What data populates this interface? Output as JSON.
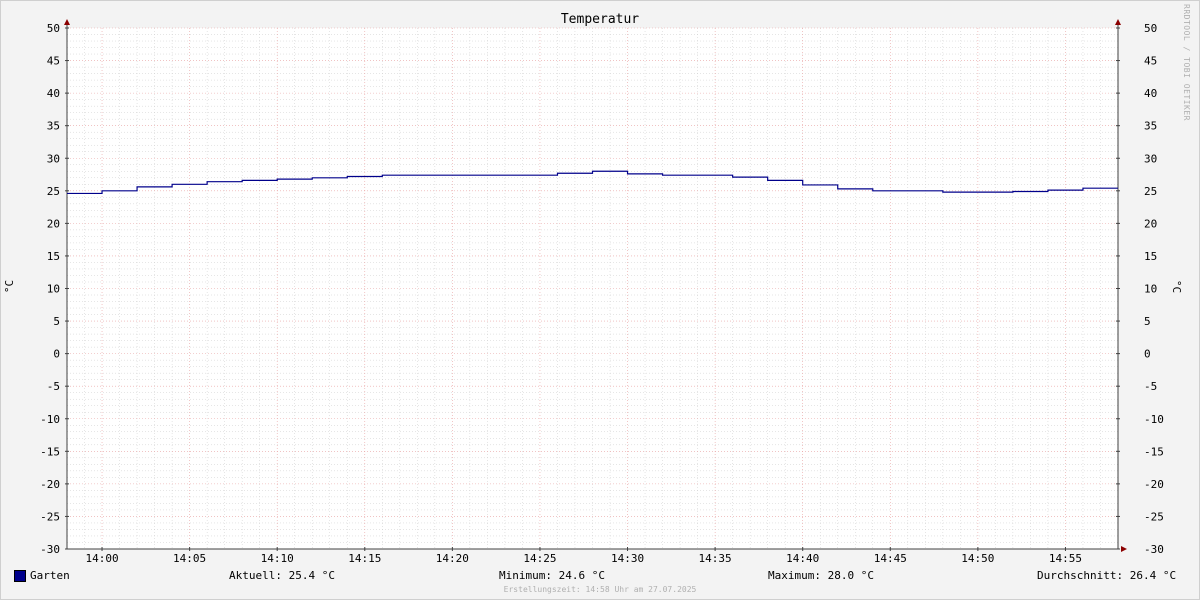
{
  "chart_data": {
    "type": "line",
    "title": "Temperatur",
    "ylabel": "°C",
    "ylim": [
      -30,
      50
    ],
    "y_ticks": [
      50,
      45,
      40,
      35,
      30,
      25,
      20,
      15,
      10,
      5,
      0,
      -5,
      -10,
      -15,
      -20,
      -25,
      -30
    ],
    "x_ticks": [
      "14:00",
      "14:05",
      "14:10",
      "14:15",
      "14:20",
      "14:25",
      "14:30",
      "14:35",
      "14:40",
      "14:45",
      "14:50",
      "14:55"
    ],
    "x_range": [
      "13:58",
      "14:58"
    ],
    "grid": true,
    "step": true,
    "series": [
      {
        "name": "Garten",
        "color": "#00008b",
        "points": [
          [
            "13:58",
            24.6
          ],
          [
            "14:00",
            25.0
          ],
          [
            "14:02",
            25.6
          ],
          [
            "14:04",
            26.0
          ],
          [
            "14:06",
            26.4
          ],
          [
            "14:08",
            26.6
          ],
          [
            "14:10",
            26.8
          ],
          [
            "14:12",
            27.0
          ],
          [
            "14:14",
            27.2
          ],
          [
            "14:16",
            27.4
          ],
          [
            "14:18",
            27.4
          ],
          [
            "14:20",
            27.4
          ],
          [
            "14:22",
            27.4
          ],
          [
            "14:24",
            27.4
          ],
          [
            "14:26",
            27.7
          ],
          [
            "14:28",
            28.0
          ],
          [
            "14:30",
            27.6
          ],
          [
            "14:32",
            27.4
          ],
          [
            "14:34",
            27.4
          ],
          [
            "14:36",
            27.1
          ],
          [
            "14:38",
            26.6
          ],
          [
            "14:40",
            25.9
          ],
          [
            "14:42",
            25.3
          ],
          [
            "14:44",
            25.0
          ],
          [
            "14:46",
            25.0
          ],
          [
            "14:48",
            24.8
          ],
          [
            "14:50",
            24.8
          ],
          [
            "14:52",
            24.9
          ],
          [
            "14:54",
            25.1
          ],
          [
            "14:56",
            25.4
          ],
          [
            "14:58",
            25.4
          ]
        ]
      }
    ]
  },
  "unit_label": "°C",
  "watermark": "RRDTOOL / TOBI OETIKER",
  "legend": {
    "series_name": "Garten",
    "aktuell": "Aktuell: 25.4 °C",
    "minimum": "Minimum: 24.6 °C",
    "maximum": "Maximum: 28.0 °C",
    "durchschnitt": "Durchschnitt: 26.4 °C"
  },
  "footer": "Erstellungszeit: 14:58 Uhr am 27.07.2025",
  "colors": {
    "background": "#f3f3f3",
    "plot_background": "#ffffff",
    "major_grid": "#e8a0a0",
    "minor_grid": "#cccccc",
    "series": "#00008b",
    "axis": "#404040",
    "arrow": "#8b0000"
  }
}
